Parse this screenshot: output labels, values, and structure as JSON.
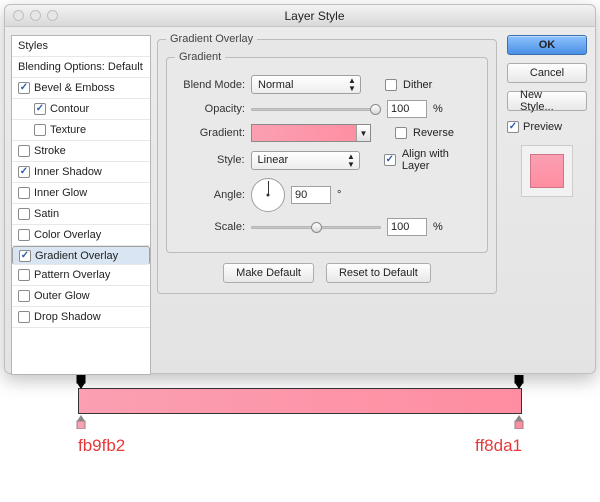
{
  "title": "Layer Style",
  "sidebar": {
    "header": "Styles",
    "blending": "Blending Options: Default",
    "items": [
      {
        "label": "Bevel & Emboss",
        "checked": true,
        "indent": false
      },
      {
        "label": "Contour",
        "checked": true,
        "indent": true
      },
      {
        "label": "Texture",
        "checked": false,
        "indent": true
      },
      {
        "label": "Stroke",
        "checked": false,
        "indent": false
      },
      {
        "label": "Inner Shadow",
        "checked": true,
        "indent": false
      },
      {
        "label": "Inner Glow",
        "checked": false,
        "indent": false
      },
      {
        "label": "Satin",
        "checked": false,
        "indent": false
      },
      {
        "label": "Color Overlay",
        "checked": false,
        "indent": false
      },
      {
        "label": "Gradient Overlay",
        "checked": true,
        "indent": false,
        "selected": true
      },
      {
        "label": "Pattern Overlay",
        "checked": false,
        "indent": false
      },
      {
        "label": "Outer Glow",
        "checked": false,
        "indent": false
      },
      {
        "label": "Drop Shadow",
        "checked": false,
        "indent": false
      }
    ]
  },
  "panel": {
    "outer_legend": "Gradient Overlay",
    "inner_legend": "Gradient",
    "labels": {
      "blend": "Blend Mode:",
      "opacity": "Opacity:",
      "gradient": "Gradient:",
      "style": "Style:",
      "angle": "Angle:",
      "scale": "Scale:"
    },
    "blend_mode": "Normal",
    "dither": {
      "label": "Dither",
      "checked": false
    },
    "opacity": {
      "value": "100",
      "suffix": "%",
      "pos": 100
    },
    "reverse": {
      "label": "Reverse",
      "checked": false
    },
    "style": "Linear",
    "align": {
      "label": "Align with Layer",
      "checked": true
    },
    "angle": {
      "value": "90",
      "suffix": "°"
    },
    "scale": {
      "value": "100",
      "suffix": "%",
      "pos": 50
    },
    "make_default": "Make Default",
    "reset_default": "Reset to Default"
  },
  "actions": {
    "ok": "OK",
    "cancel": "Cancel",
    "new_style": "New Style...",
    "preview": "Preview"
  },
  "editor": {
    "left": "fb9fb2",
    "right": "ff8da1"
  },
  "colors": {
    "grad_start": "#fb9fb2",
    "grad_end": "#ff8da1",
    "accent": "#4a90e4"
  }
}
